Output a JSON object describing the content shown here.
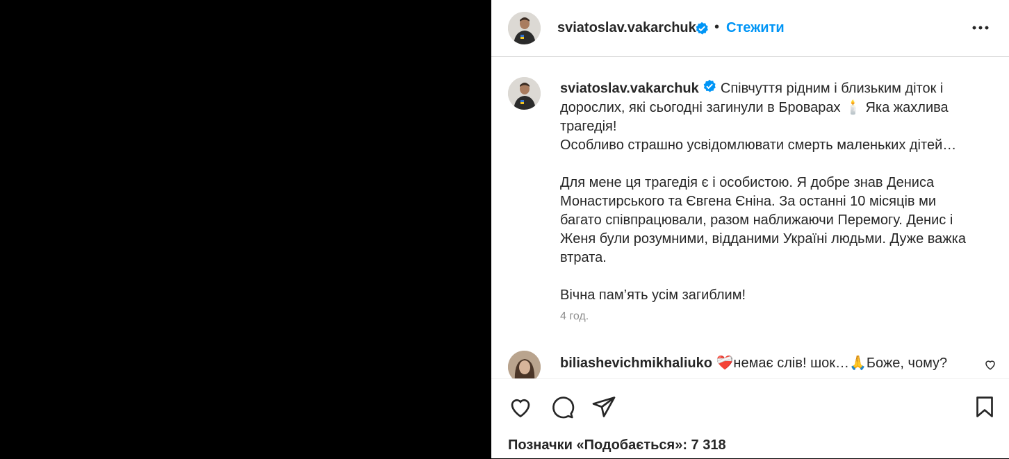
{
  "header": {
    "username": "sviatoslav.vakarchuk",
    "separator": "•",
    "follow_label": "Стежити",
    "more_icon": "more-icon"
  },
  "caption": {
    "username": "sviatoslav.vakarchuk",
    "line1": "Співчуття рідним і близьким діток і дорослих, які сьогодні загинули в Броварах 🕯️ Яка жахлива трагедія!",
    "line2": "Особливо страшно усвідомлювати смерть маленьких дітей…",
    "line3": "Для мене ця трагедія є і особистою. Я добре знав Дениса Монастирського та Євгена Єніна. За останні 10 місяців ми багато співпрацювали, разом наближаючи Перемогу. Денис і Женя були розумними, відданими Україні людьми. Дуже важка втрата.",
    "line4": "Вічна пам’ять усім загиблим!",
    "time": "4 год."
  },
  "comment": {
    "username": "biliashevichmikhaliuko",
    "text": " ❤️‍🩹немає слів! шок…🙏Боже, чому?"
  },
  "likes": {
    "text": "Позначки «Подобається»: 7 318"
  },
  "colors": {
    "accent": "#0095f6",
    "text": "#262626",
    "muted": "#8e8e8e"
  }
}
